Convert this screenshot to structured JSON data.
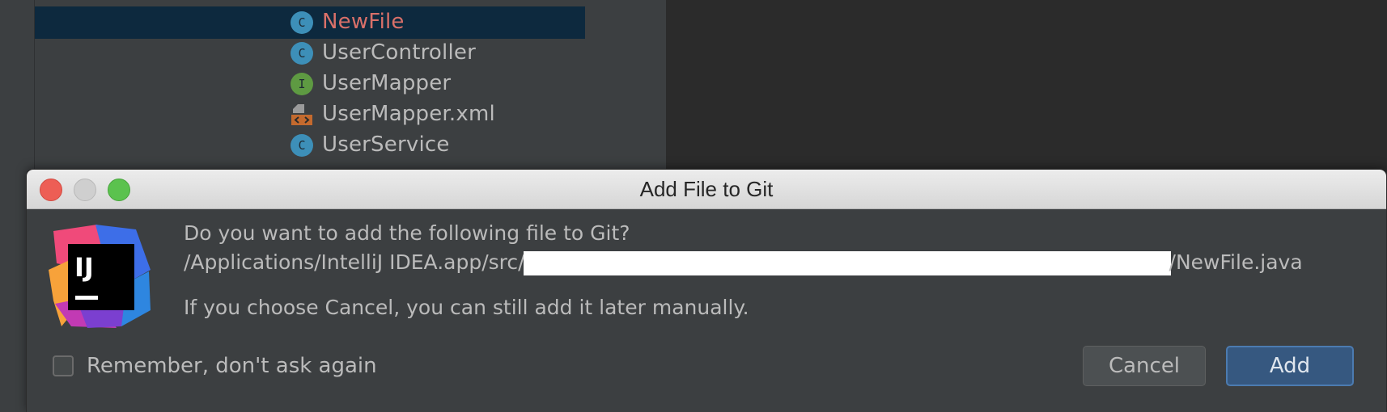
{
  "project_tree": {
    "items": [
      {
        "label": "NewFile",
        "icon": "class-icon",
        "icon_glyph": "C",
        "modified": true,
        "selected": true
      },
      {
        "label": "UserController",
        "icon": "class-icon",
        "icon_glyph": "C"
      },
      {
        "label": "UserMapper",
        "icon": "interface-icon",
        "icon_glyph": "I"
      },
      {
        "label": "UserMapper.xml",
        "icon": "xml-file-icon"
      },
      {
        "label": "UserService",
        "icon": "class-icon",
        "icon_glyph": "C"
      }
    ]
  },
  "dialog": {
    "title": "Add File to Git",
    "question": "Do you want to add the following file to Git?",
    "path_prefix": "/Applications/IntelliJ IDEA.app/src/",
    "path_suffix": "/NewFile.java",
    "hint": "If you choose Cancel, you can still add it later manually.",
    "remember_label": "Remember, don't ask again",
    "remember_checked": false,
    "cancel_label": "Cancel",
    "add_label": "Add",
    "logo_text": "IJ"
  },
  "colors": {
    "modified_file": "#d97069",
    "selection": "#0d293e",
    "default_button": "#365880"
  }
}
